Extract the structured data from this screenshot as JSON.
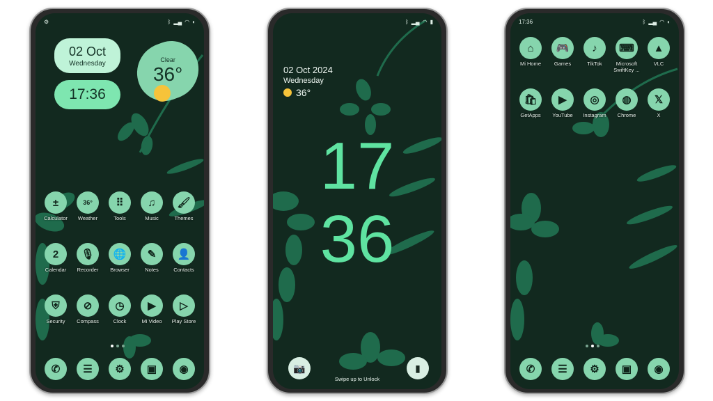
{
  "colors": {
    "background": "#12291f",
    "icon": "#86d5ad",
    "accent_clock": "#5fe3a1",
    "sun": "#f6c33a"
  },
  "home1": {
    "status_left_icon": "settings-dot",
    "date_widget": {
      "date": "02 Oct",
      "day": "Wednesday"
    },
    "time_widget": {
      "time": "17:36"
    },
    "weather_widget": {
      "condition": "Clear",
      "temp": "36°",
      "icon": "sun"
    },
    "apps": [
      {
        "label": "Calculator",
        "icon": "calculator",
        "glyph": "±"
      },
      {
        "label": "Weather",
        "icon": "weather",
        "glyph": "36°"
      },
      {
        "label": "Tools",
        "icon": "tools-grid",
        "glyph": "⠿"
      },
      {
        "label": "Music",
        "icon": "music-note",
        "glyph": "♫"
      },
      {
        "label": "Themes",
        "icon": "paint-roller",
        "glyph": "🖌"
      },
      {
        "label": "Calendar",
        "icon": "calendar",
        "glyph": "2"
      },
      {
        "label": "Recorder",
        "icon": "microphone",
        "glyph": "🎙"
      },
      {
        "label": "Browser",
        "icon": "globe",
        "glyph": "🌐"
      },
      {
        "label": "Notes",
        "icon": "notes",
        "glyph": "✎"
      },
      {
        "label": "Contacts",
        "icon": "person",
        "glyph": "👤"
      },
      {
        "label": "Security",
        "icon": "shield",
        "glyph": "⛨"
      },
      {
        "label": "Compass",
        "icon": "compass",
        "glyph": "⊘"
      },
      {
        "label": "Clock",
        "icon": "clock",
        "glyph": "◷"
      },
      {
        "label": "Mi Video",
        "icon": "play",
        "glyph": "▶"
      },
      {
        "label": "Play Store",
        "icon": "play-store",
        "glyph": "▷"
      }
    ],
    "dock": [
      {
        "icon": "phone",
        "glyph": "✆"
      },
      {
        "icon": "messages",
        "glyph": "☰"
      },
      {
        "icon": "settings",
        "glyph": "⚙"
      },
      {
        "icon": "gallery",
        "glyph": "▣"
      },
      {
        "icon": "camera",
        "glyph": "◉"
      }
    ]
  },
  "lock": {
    "date": "02 Oct 2024",
    "day": "Wednesday",
    "temp": "36°",
    "hour": "17",
    "minute": "36",
    "hint": "Swipe up to Unlock",
    "left_button_icon": "camera",
    "right_button_icon": "flashlight"
  },
  "home2": {
    "status_time": "17:36",
    "apps": [
      {
        "label": "Mi Home",
        "icon": "mi-home",
        "glyph": "⌂"
      },
      {
        "label": "Games",
        "icon": "gamepad",
        "glyph": "🎮"
      },
      {
        "label": "TikTok",
        "icon": "tiktok",
        "glyph": "♪"
      },
      {
        "label": "Microsoft SwiftKey ...",
        "icon": "swiftkey",
        "glyph": "⌨"
      },
      {
        "label": "VLC",
        "icon": "vlc-cone",
        "glyph": "▲"
      },
      {
        "label": "GetApps",
        "icon": "shopping-bag",
        "glyph": "🛍"
      },
      {
        "label": "YouTube",
        "icon": "youtube",
        "glyph": "▶"
      },
      {
        "label": "Instagram",
        "icon": "instagram",
        "glyph": "◎"
      },
      {
        "label": "Chrome",
        "icon": "chrome",
        "glyph": "◍"
      },
      {
        "label": "X",
        "icon": "x-logo",
        "glyph": "𝕏"
      }
    ],
    "dock": [
      {
        "icon": "phone",
        "glyph": "✆"
      },
      {
        "icon": "messages",
        "glyph": "☰"
      },
      {
        "icon": "settings",
        "glyph": "⚙"
      },
      {
        "icon": "gallery",
        "glyph": "▣"
      },
      {
        "icon": "camera",
        "glyph": "◉"
      }
    ]
  }
}
